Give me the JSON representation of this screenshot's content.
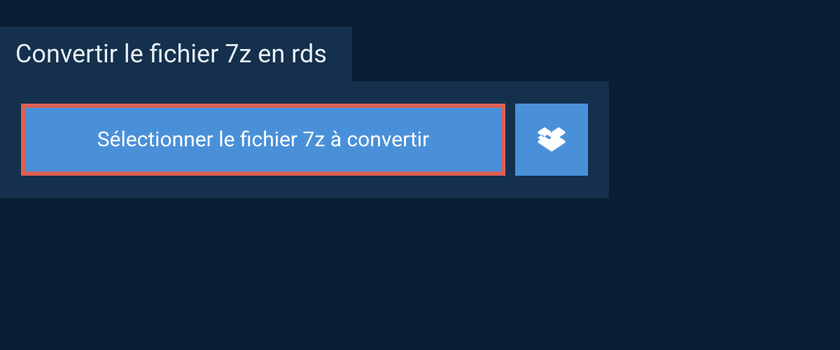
{
  "header": {
    "title": "Convertir le fichier 7z en rds"
  },
  "actions": {
    "select_file_label": "Sélectionner le fichier 7z à convertir"
  }
}
